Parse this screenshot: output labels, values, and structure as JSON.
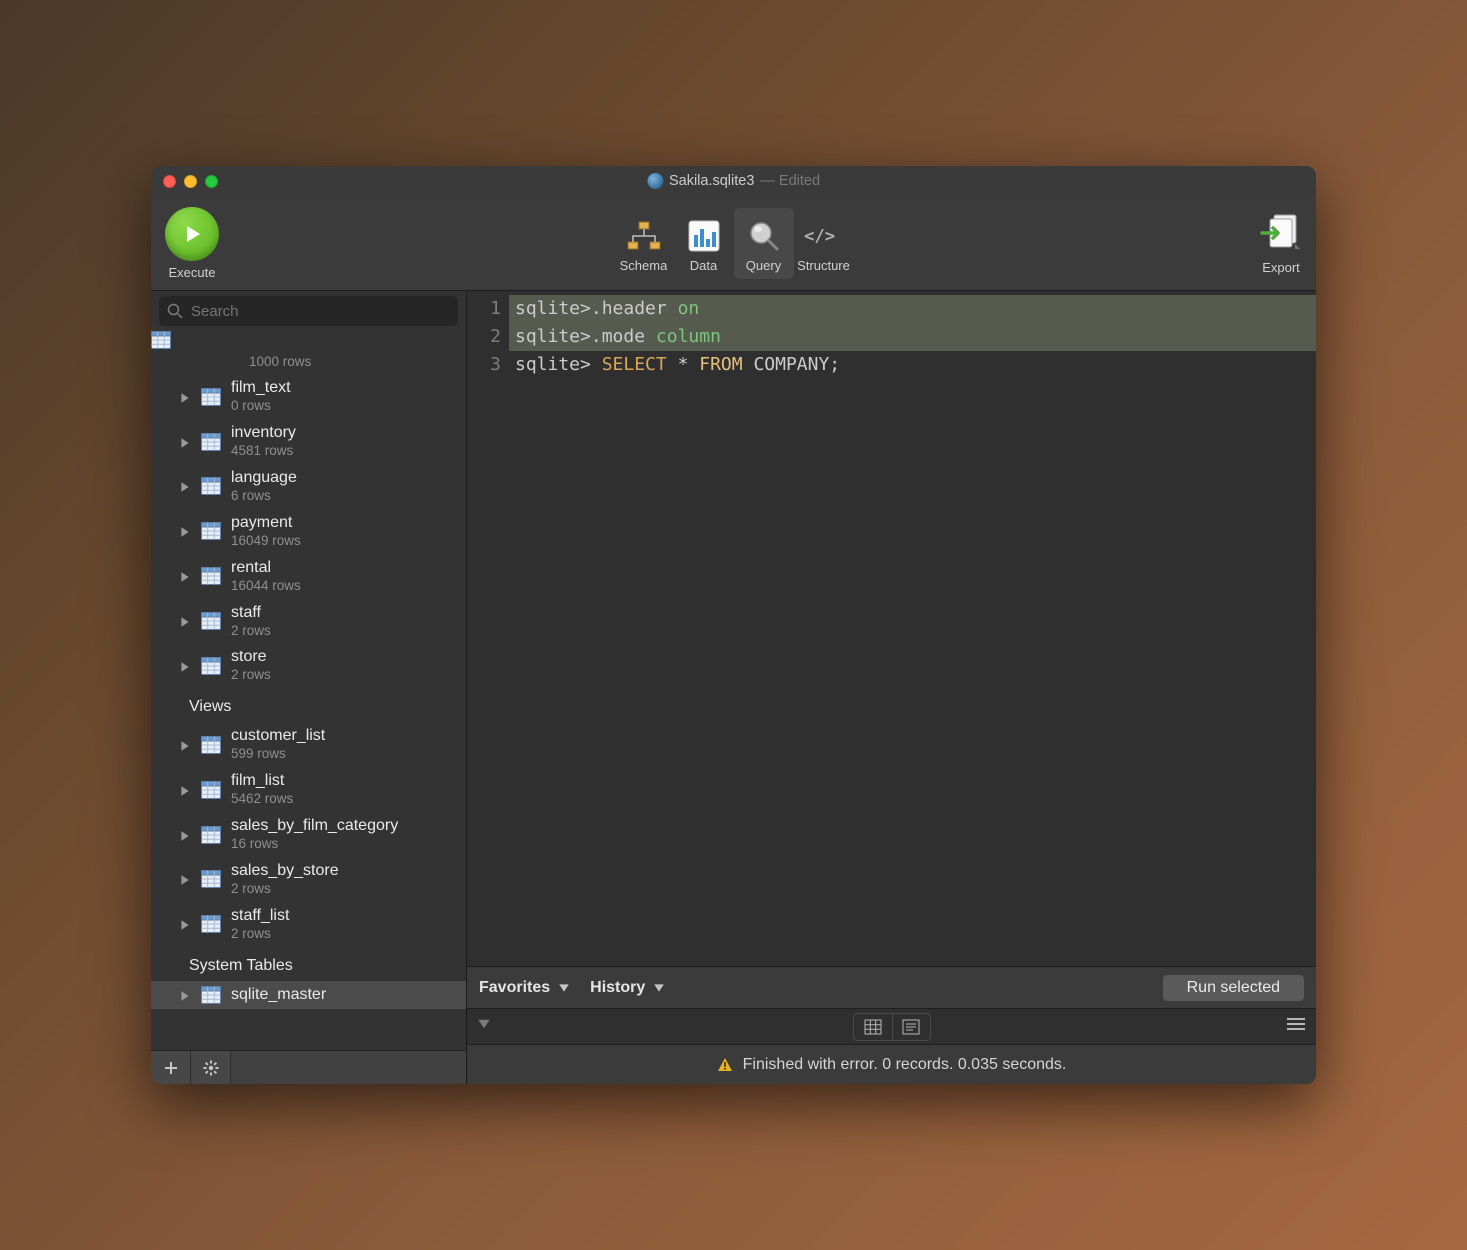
{
  "window": {
    "title": "Sakila.sqlite3",
    "edited_label": "— Edited"
  },
  "toolbar": {
    "execute_label": "Execute",
    "tabs": {
      "schema": "Schema",
      "data": "Data",
      "query": "Query",
      "structure": "Structure"
    },
    "export_label": "Export"
  },
  "search": {
    "placeholder": "Search"
  },
  "tree": {
    "partial_rows": "1000 rows",
    "tables": [
      {
        "name": "film_text",
        "rows": "0 rows"
      },
      {
        "name": "inventory",
        "rows": "4581 rows"
      },
      {
        "name": "language",
        "rows": "6 rows"
      },
      {
        "name": "payment",
        "rows": "16049 rows"
      },
      {
        "name": "rental",
        "rows": "16044 rows"
      },
      {
        "name": "staff",
        "rows": "2 rows"
      },
      {
        "name": "store",
        "rows": "2 rows"
      }
    ],
    "views_header": "Views",
    "views": [
      {
        "name": "customer_list",
        "rows": "599 rows"
      },
      {
        "name": "film_list",
        "rows": "5462 rows"
      },
      {
        "name": "sales_by_film_category",
        "rows": "16 rows"
      },
      {
        "name": "sales_by_store",
        "rows": "2 rows"
      },
      {
        "name": "staff_list",
        "rows": "2 rows"
      }
    ],
    "system_header": "System Tables",
    "system": [
      {
        "name": "sqlite_master"
      }
    ]
  },
  "editor": {
    "lines": [
      {
        "num": "1",
        "prompt": "sqlite>",
        "cmd": ".header ",
        "arg": "on"
      },
      {
        "num": "2",
        "prompt": "sqlite>",
        "cmd": ".mode ",
        "arg": "column"
      },
      {
        "num": "3",
        "prompt": "sqlite> ",
        "s": "SELECT",
        "star": " * ",
        "f": "FROM",
        "t": " COMPANY;"
      }
    ]
  },
  "editor_toolbar": {
    "favorites": "Favorites",
    "history": "History",
    "run_selected": "Run selected"
  },
  "status": {
    "message": "Finished with error. 0 records. 0.035 seconds."
  }
}
